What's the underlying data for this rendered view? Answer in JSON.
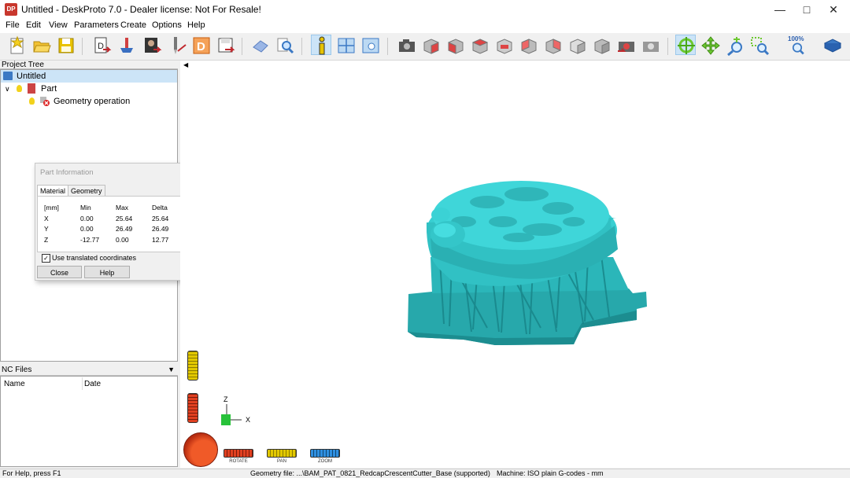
{
  "window": {
    "title": "Untitled - DeskProto 7.0 - Dealer license: Not For Resale!",
    "app_icon_text": "DP"
  },
  "menu": [
    "File",
    "Edit",
    "View",
    "Parameters",
    "Create",
    "Options",
    "Help"
  ],
  "toolbar": {
    "zoom_percent_label": "100%"
  },
  "project_tree": {
    "header": "Project Tree",
    "root": "Untitled",
    "part": "Part",
    "operation": "Geometry operation"
  },
  "part_info": {
    "title": "Part Information",
    "tabs": [
      "Material",
      "Geometry"
    ],
    "columns": [
      "[mm]",
      "Min",
      "Max",
      "Delta"
    ],
    "rows": [
      [
        "X",
        "0.00",
        "25.64",
        "25.64"
      ],
      [
        "Y",
        "0.00",
        "26.49",
        "26.49"
      ],
      [
        "Z",
        "-12.77",
        "0.00",
        "12.77"
      ]
    ],
    "checkbox_label": "Use translated coordinates",
    "checkbox_checked": true,
    "close_label": "Close",
    "help_label": "Help"
  },
  "nc_files": {
    "header": "NC Files",
    "col_name": "Name",
    "col_date": "Date"
  },
  "view_controls": {
    "rotate": "ROTATE",
    "pan": "PAN",
    "zoom": "ZOOM",
    "axis_z": "Z",
    "axis_x": "X"
  },
  "status": {
    "help": "For Help, press F1",
    "geometry": "Geometry file: ...\\BAM_PAT_0821_RedcapCrescentCutter_Base (supported)",
    "machine": "Machine: ISO plain G-codes - mm"
  },
  "colors": {
    "model": "#35c9cc",
    "model_shade": "#1f9ea3",
    "selection": "#cce4f7"
  }
}
